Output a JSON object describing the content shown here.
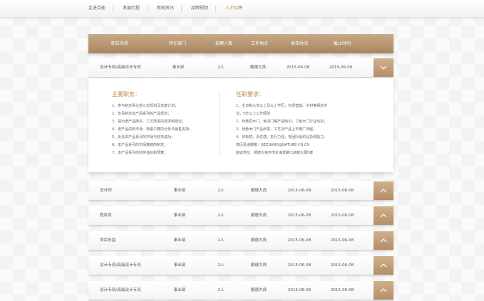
{
  "nav": {
    "items": [
      {
        "label": "走进百能",
        "active": false
      },
      {
        "label": "发展历程",
        "active": false
      },
      {
        "label": "新闻资讯",
        "active": false
      },
      {
        "label": "品牌视频",
        "active": false
      },
      {
        "label": "人才招聘",
        "active": true
      }
    ]
  },
  "table": {
    "headers": [
      "职位名称",
      "所在部门",
      "招聘人数",
      "工作地点",
      "发布时间",
      "截止时间"
    ]
  },
  "expanded_row": {
    "position": "设计专员/高级设计专员",
    "department": "事业部",
    "count": "2人",
    "location": "顺德大良",
    "publish": "2015-06-08",
    "deadline": "2015-06-08",
    "duties_title": "主要职务：",
    "duties": [
      "1、参与制定事业部三年规划及年度计划；",
      "2、负责制定本产品系列的产品规划；",
      "3、提出老产品降本、工艺改进的需求和建议；",
      "4、老产品的新市场、新客户群的分析与销售支持；",
      "5、负责本产品系列的市场与财务成功；",
      "6、本产品系列的市场策略的制定；",
      "7、本产品系列的财务指标和预算；"
    ],
    "requirements_title": "任职要求：",
    "requirements": [
      "1、全日制大专以上及以上学历，市场营销、木材等相关专",
      "业，5年以上工作经验",
      "2、熟悉原木门、免漆门等产品知识，了解木门行业动态；",
      "3、熟悉木门产品研发、工艺及产品上市推广流程；",
      "4、目标感，责任感，执行力强，有团队组织及协调能力。",
      "简历投递邮箱：NEZHANG@NATURE-CN.CN",
      "面试地址：顺德大良环市东海景路口卓越大厦5楼"
    ]
  },
  "rows": [
    {
      "position": "设计师",
      "department": "事业部",
      "count": "2人",
      "location": "顺德大良",
      "publish": "2015-06-08",
      "deadline": "2015-06-08"
    },
    {
      "position": "程序员",
      "department": "事业部",
      "count": "2人",
      "location": "顺德大良",
      "publish": "2015-06-08",
      "deadline": "2015-06-08"
    },
    {
      "position": "项目总监",
      "department": "事业部",
      "count": "2人",
      "location": "顺德大良",
      "publish": "2015-06-08",
      "deadline": "2015-06-08"
    },
    {
      "position": "设计专员/高级设计专员",
      "department": "事业部",
      "count": "2人",
      "location": "顺德大良",
      "publish": "2015-06-08",
      "deadline": "2015-06-08"
    },
    {
      "position": "设计专员/高级设计专员",
      "department": "事业部",
      "count": "2人",
      "location": "顺德大良",
      "publish": "2015-06-08",
      "deadline": "2015-06-08"
    }
  ],
  "icons": {
    "expanded": "chevron-down-icon",
    "collapsed": "chevron-up-icon"
  },
  "colors": {
    "accent": "#b48e68",
    "title": "#c08a4a",
    "active_nav": "#b08a62"
  }
}
